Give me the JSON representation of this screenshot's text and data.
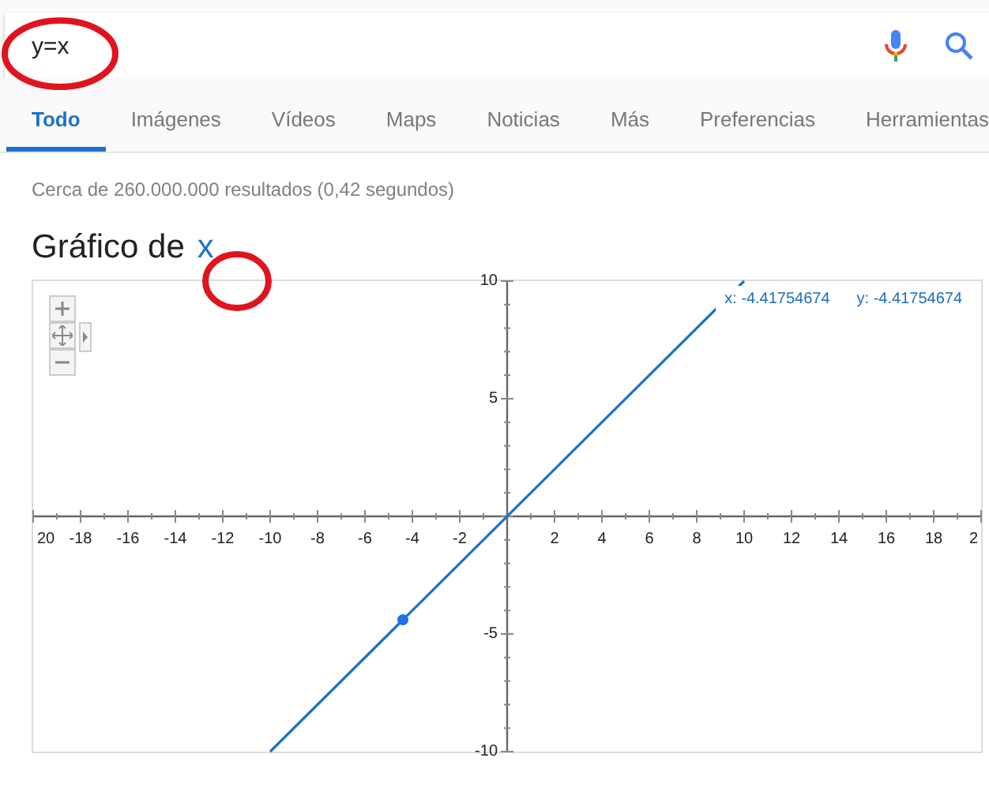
{
  "search": {
    "value": "y=x"
  },
  "tabs": [
    {
      "label": "Todo",
      "selected": true
    },
    {
      "label": "Imágenes",
      "selected": false
    },
    {
      "label": "Vídeos",
      "selected": false
    },
    {
      "label": "Maps",
      "selected": false
    },
    {
      "label": "Noticias",
      "selected": false
    },
    {
      "label": "Más",
      "selected": false
    },
    {
      "label": "Preferencias",
      "selected": false
    },
    {
      "label": "Herramientas",
      "selected": false
    }
  ],
  "result_stats": "Cerca de 260.000.000 resultados (0,42 segundos)",
  "graph": {
    "title": "Gráfico de",
    "function": "x",
    "edge_tick_label": "2",
    "chart_data": {
      "type": "line",
      "x": [
        -10,
        10
      ],
      "series": [
        {
          "color": "#1a73c8",
          "values": [
            -10,
            10
          ]
        },
        {
          "color": "#1a73e8",
          "marker": "circle",
          "x": [
            -4.4
          ],
          "values": [
            -4.4
          ]
        }
      ],
      "xlim": [
        -20,
        20
      ],
      "ylim": [
        -10,
        10
      ],
      "xticks": [
        {
          "value": -20,
          "label": "20"
        },
        -18,
        -16,
        -14,
        -12,
        -10,
        -8,
        -6,
        -4,
        -2,
        2,
        4,
        6,
        8,
        10,
        12,
        14,
        16,
        18
      ],
      "yticks": [
        10,
        5,
        -5,
        -10
      ],
      "annotations": [
        "x: -4.41754674",
        "y: -4.41754674"
      ]
    }
  }
}
